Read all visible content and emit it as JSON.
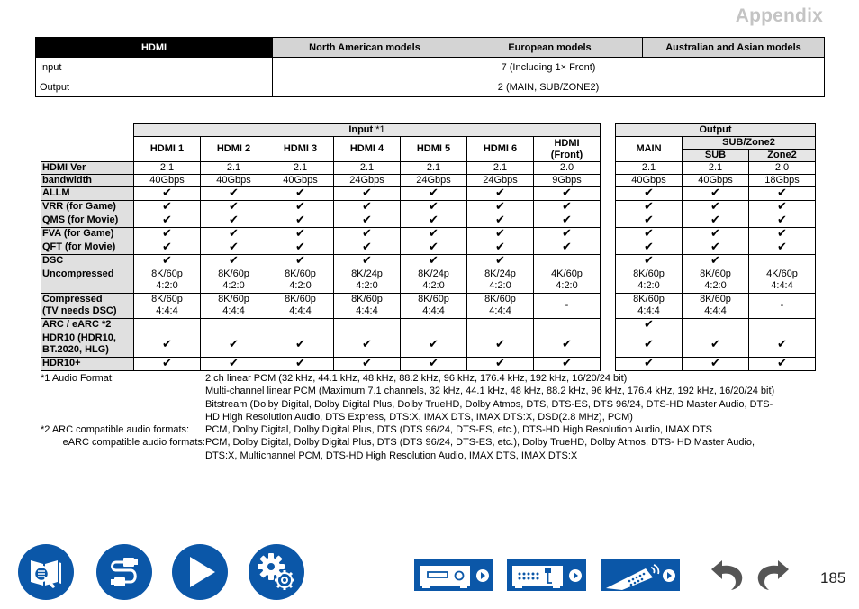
{
  "header": {
    "section_title": "Appendix"
  },
  "summary_table": {
    "headers": [
      "HDMI",
      "North American models",
      "European models",
      "Australian and Asian models"
    ],
    "rows": [
      {
        "label": "Input",
        "value": "7 (Including 1× Front)"
      },
      {
        "label": "Output",
        "value": "2 (MAIN, SUB/ZONE2)"
      }
    ]
  },
  "spec_table": {
    "input_group": "Input",
    "input_group_note": " *1",
    "output_group": "Output",
    "sub_zone2_group": "SUB/Zone2",
    "input_columns": [
      "HDMI 1",
      "HDMI 2",
      "HDMI 3",
      "HDMI 4",
      "HDMI 5",
      "HDMI 6",
      "HDMI\n(Front)"
    ],
    "input_columns_display": [
      "HDMI 1",
      "HDMI 2",
      "HDMI 3",
      "HDMI 4",
      "HDMI 5",
      "HDMI 6",
      "HDMI",
      "(Front)"
    ],
    "output_main": "MAIN",
    "output_sub": "SUB",
    "output_zone2": "Zone2",
    "check_symbol": "✔",
    "rows": [
      {
        "label": "HDMI Ver",
        "input": [
          "2.1",
          "2.1",
          "2.1",
          "2.1",
          "2.1",
          "2.1",
          "2.0"
        ],
        "output": [
          "2.1",
          "2.1",
          "2.0"
        ]
      },
      {
        "label": "bandwidth",
        "input": [
          "40Gbps",
          "40Gbps",
          "40Gbps",
          "24Gbps",
          "24Gbps",
          "24Gbps",
          "9Gbps"
        ],
        "output": [
          "40Gbps",
          "40Gbps",
          "18Gbps"
        ]
      },
      {
        "label": "ALLM",
        "input": [
          "✔",
          "✔",
          "✔",
          "✔",
          "✔",
          "✔",
          "✔"
        ],
        "output": [
          "✔",
          "✔",
          "✔"
        ]
      },
      {
        "label": "VRR (for Game)",
        "input": [
          "✔",
          "✔",
          "✔",
          "✔",
          "✔",
          "✔",
          "✔"
        ],
        "output": [
          "✔",
          "✔",
          "✔"
        ]
      },
      {
        "label": "QMS (for Movie)",
        "input": [
          "✔",
          "✔",
          "✔",
          "✔",
          "✔",
          "✔",
          "✔"
        ],
        "output": [
          "✔",
          "✔",
          "✔"
        ]
      },
      {
        "label": "FVA (for Game)",
        "input": [
          "✔",
          "✔",
          "✔",
          "✔",
          "✔",
          "✔",
          "✔"
        ],
        "output": [
          "✔",
          "✔",
          "✔"
        ]
      },
      {
        "label": "QFT (for Movie)",
        "input": [
          "✔",
          "✔",
          "✔",
          "✔",
          "✔",
          "✔",
          "✔"
        ],
        "output": [
          "✔",
          "✔",
          "✔"
        ]
      },
      {
        "label": "DSC",
        "input": [
          "✔",
          "✔",
          "✔",
          "✔",
          "✔",
          "✔",
          ""
        ],
        "output": [
          "✔",
          "✔",
          ""
        ]
      },
      {
        "label": "Uncompressed",
        "input": [
          [
            "8K/60p",
            "4:2:0"
          ],
          [
            "8K/60p",
            "4:2:0"
          ],
          [
            "8K/60p",
            "4:2:0"
          ],
          [
            "8K/24p",
            "4:2:0"
          ],
          [
            "8K/24p",
            "4:2:0"
          ],
          [
            "8K/24p",
            "4:2:0"
          ],
          [
            "4K/60p",
            "4:2:0"
          ]
        ],
        "output": [
          [
            "8K/60p",
            "4:2:0"
          ],
          [
            "8K/60p",
            "4:2:0"
          ],
          [
            "4K/60p",
            "4:4:4"
          ]
        ]
      },
      {
        "label": [
          "Compressed",
          "(TV needs DSC)"
        ],
        "input": [
          [
            "8K/60p",
            "4:4:4"
          ],
          [
            "8K/60p",
            "4:4:4"
          ],
          [
            "8K/60p",
            "4:4:4"
          ],
          [
            "8K/60p",
            "4:4:4"
          ],
          [
            "8K/60p",
            "4:4:4"
          ],
          [
            "8K/60p",
            "4:4:4"
          ],
          "-"
        ],
        "output": [
          [
            "8K/60p",
            "4:4:4"
          ],
          [
            "8K/60p",
            "4:4:4"
          ],
          "-"
        ]
      },
      {
        "label": "ARC / eARC *2",
        "input": [
          "",
          "",
          "",
          "",
          "",
          "",
          ""
        ],
        "output": [
          "✔",
          "",
          ""
        ]
      },
      {
        "label": [
          "HDR10 (HDR10,",
          "BT.2020, HLG)"
        ],
        "input": [
          "✔",
          "✔",
          "✔",
          "✔",
          "✔",
          "✔",
          "✔"
        ],
        "output": [
          "✔",
          "✔",
          "✔"
        ]
      },
      {
        "label": "HDR10+",
        "input": [
          "✔",
          "✔",
          "✔",
          "✔",
          "✔",
          "✔",
          "✔"
        ],
        "output": [
          "✔",
          "✔",
          "✔"
        ]
      }
    ]
  },
  "footnotes": [
    {
      "key": "*1 Audio Format:",
      "lines": [
        "2 ch linear PCM (32 kHz, 44.1 kHz, 48 kHz, 88.2 kHz, 96 kHz, 176.4 kHz, 192 kHz, 16/20/24 bit)",
        "Multi-channel linear PCM (Maximum 7.1 channels, 32 kHz, 44.1 kHz, 48 kHz, 88.2 kHz, 96 kHz, 176.4 kHz, 192 kHz, 16/20/24 bit)",
        "Bitstream (Dolby Digital, Dolby Digital Plus, Dolby TrueHD, Dolby Atmos, DTS, DTS-ES, DTS 96/24, DTS-HD Master Audio, DTS-",
        "HD High Resolution Audio, DTS Express, DTS:X, IMAX DTS, IMAX DTS:X, DSD(2.8 MHz), PCM)"
      ]
    },
    {
      "key": "*2 ARC compatible audio formats:",
      "lines": [
        "PCM, Dolby Digital, Dolby Digital Plus, DTS (DTS 96/24, DTS-ES, etc.), DTS-HD High Resolution Audio, IMAX DTS"
      ]
    },
    {
      "key": "eARC compatible audio formats:",
      "lines": [
        "PCM, Dolby Digital, Dolby Digital Plus, DTS (DTS 96/24, DTS-ES, etc.), Dolby TrueHD, Dolby Atmos, DTS- HD Master Audio,",
        "DTS:X, Multichannel PCM, DTS-HD High Resolution Audio, IMAX DTS, IMAX DTS:X"
      ]
    }
  ],
  "footer": {
    "nav_icons": [
      "contents-book-search-icon",
      "connections-cable-icon",
      "playback-icon",
      "setup-gear-icon"
    ],
    "device_buttons": [
      "front-panel-button",
      "rear-panel-button",
      "remote-controller-button"
    ],
    "page_number": "185",
    "brand_color": "#0b57a8"
  }
}
